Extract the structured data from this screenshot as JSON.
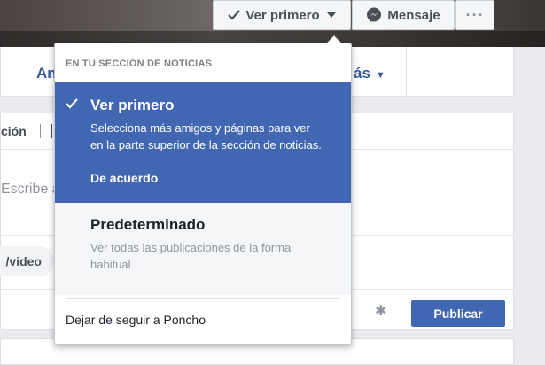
{
  "header": {
    "follow_label": "Ver primero",
    "message_label": "Mensaje",
    "more_label": "···"
  },
  "nav": {
    "left_fragment": "An",
    "right_fragment": "ás"
  },
  "composer": {
    "tab_fragment": "ción",
    "placeholder_fragment": "Escribe a",
    "photo_fragment": "/video",
    "publish_label": "Publicar"
  },
  "dropdown": {
    "header": "EN TU SECCIÓN DE NOTICIAS",
    "selected_option": {
      "title": "Ver primero",
      "description": "Selecciona más amigos y páginas para ver en la parte superior de la sección de noticias.",
      "action": "De acuerdo"
    },
    "default_option": {
      "title": "Predeterminado",
      "description": "Ver todas las publicaciones de la forma habitual"
    },
    "unfollow_label": "Dejar de seguir a Poncho"
  },
  "colors": {
    "accent": "#4267b2",
    "link": "#365899",
    "page_bg": "#e9ebee"
  },
  "icons": {
    "follow": "check-icon",
    "message": "messenger-icon",
    "caret": "caret-down-icon",
    "settings": "gear-icon"
  }
}
